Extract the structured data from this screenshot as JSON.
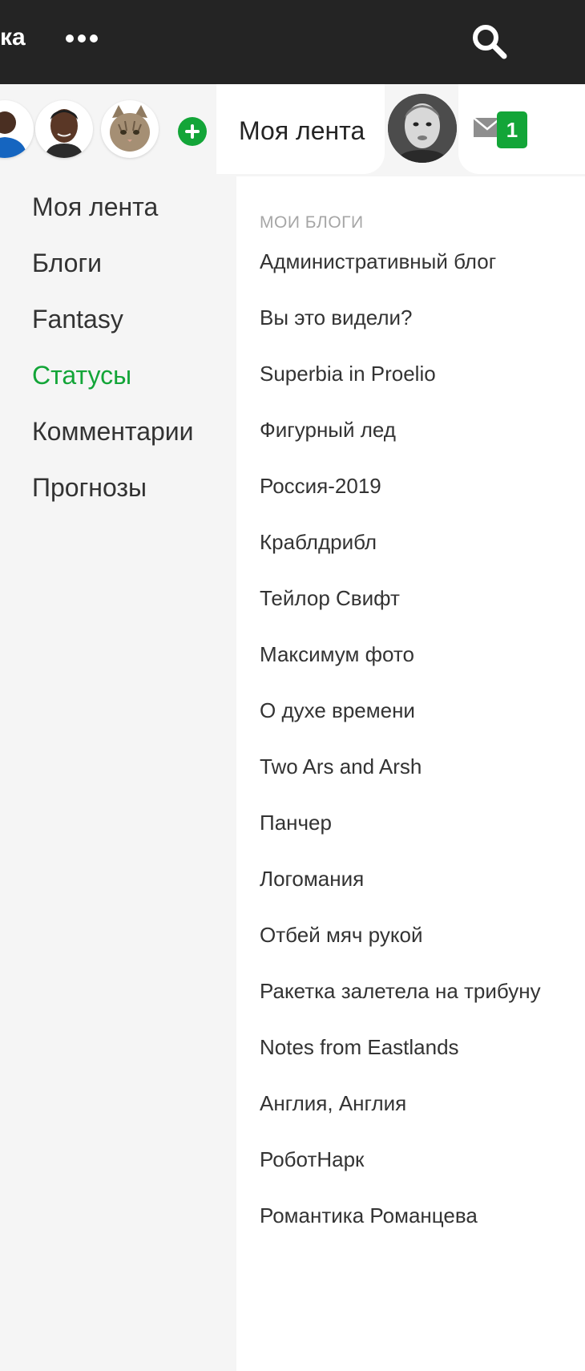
{
  "topbar": {
    "nav_cut_text": "ка",
    "more_icon": "more-dots-icon",
    "search_icon": "search-icon"
  },
  "strip": {
    "avatars": [
      {
        "name": "blue-shirt-avatar"
      },
      {
        "name": "player-avatar"
      },
      {
        "name": "cat-avatar"
      }
    ],
    "add_icon": "plus-circle-icon",
    "feed_tab_label": "Моя лента",
    "mail_icon": "envelope-icon",
    "mail_count": "1"
  },
  "left_menu": {
    "items": [
      {
        "label": "Моя лента",
        "active": false
      },
      {
        "label": "Блоги",
        "active": false
      },
      {
        "label": "Fantasy",
        "active": false
      },
      {
        "label": "Статусы",
        "active": true
      },
      {
        "label": "Комментарии",
        "active": false
      },
      {
        "label": "Прогнозы",
        "active": false
      }
    ]
  },
  "blogs": {
    "heading": "МОИ БЛОГИ",
    "items": [
      "Административный блог",
      "Вы это видели?",
      "Superbia in Proelio",
      "Фигурный лед",
      "Россия-2019",
      "Крабл­дрибл",
      "Тейлор Свифт",
      "Максимум фото",
      "О духе времени",
      "Two Ars and Arsh",
      "Панчер",
      "Логомания",
      "Отбей мяч рукой",
      "Ракетка залетела на трибуну",
      "Notes from Eastlands",
      "Англия, Англия",
      "РоботНарк",
      "Романтика Романцева"
    ]
  },
  "colors": {
    "accent": "#13a538",
    "topbar": "#242424",
    "muted": "#a6a6a6"
  }
}
